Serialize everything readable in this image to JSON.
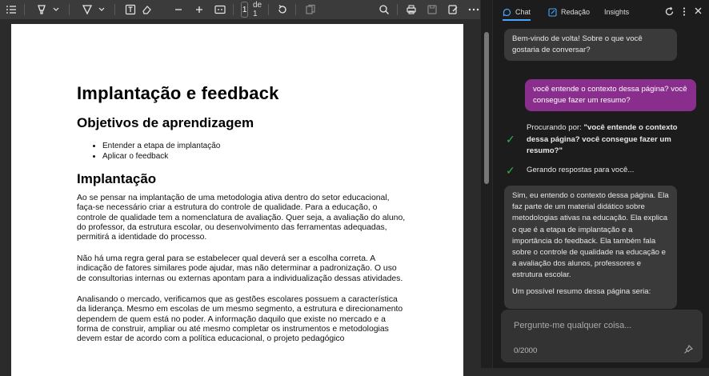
{
  "toolbar": {
    "page_current": "1",
    "page_total": "de 1"
  },
  "document": {
    "title": "Implantação e feedback",
    "section1_title": "Objetivos de aprendizagem",
    "objectives": [
      "Entender a etapa de implantação",
      "Aplicar o feedback"
    ],
    "section2_title": "Implantação",
    "paragraphs": [
      "Ao se pensar na implantação de uma metodologia ativa dentro do setor educacional, faça-se necessário criar a estrutura do controle de qualidade. Para a educação, o controle de qualidade tem a nomenclatura de avaliação. Quer seja, a avaliação do aluno, do professor, da estrutura escolar, ou desenvolvimento das ferramentas adequadas, permitirá a identidade do processo.",
      "Não há uma regra geral para se estabelecer qual deverá ser a escolha correta. A indicação de fatores similares pode ajudar, mas não determinar a padronização. O uso de consultorias internas ou externas apontam para a individualização dessas atividades.",
      "Analisando o mercado, verificamos que as gestões escolares possuem a característica da liderança. Mesmo em escolas de um mesmo segmento, a estrutura e direcionamento dependem de quem está no poder. A informação daquilo que existe no mercado e a forma de construir, ampliar ou até mesmo completar os instrumentos e metodologias devem estar de acordo com a política educacional, o projeto pedagógico"
    ]
  },
  "sidebar": {
    "tabs": [
      "Chat",
      "Redação",
      "Insights"
    ],
    "welcome": "Bem-vindo de volta! Sobre o que você gostaria de conversar?",
    "user_message": "você entende o contexto dessa página? você consegue fazer um resumo?",
    "status1_prefix": "Procurando por: ",
    "status1_query": "\"você entende o contexto dessa página? você consegue fazer um resumo?\"",
    "status2": "Gerando respostas para você...",
    "answer": "Sim, eu entendo o contexto dessa página. Ela faz parte de um material didático sobre metodologias ativas na educação. Ela explica o que é a etapa de implantação e a importância do feedback. Ela também fala sobre o controle de qualidade na educação e a avaliação dos alunos, professores e estrutura escolar.",
    "answer_continued": "Um possível resumo dessa página seria:",
    "input_placeholder": "Pergunte-me qualquer coisa...",
    "char_counter": "0/2000"
  }
}
